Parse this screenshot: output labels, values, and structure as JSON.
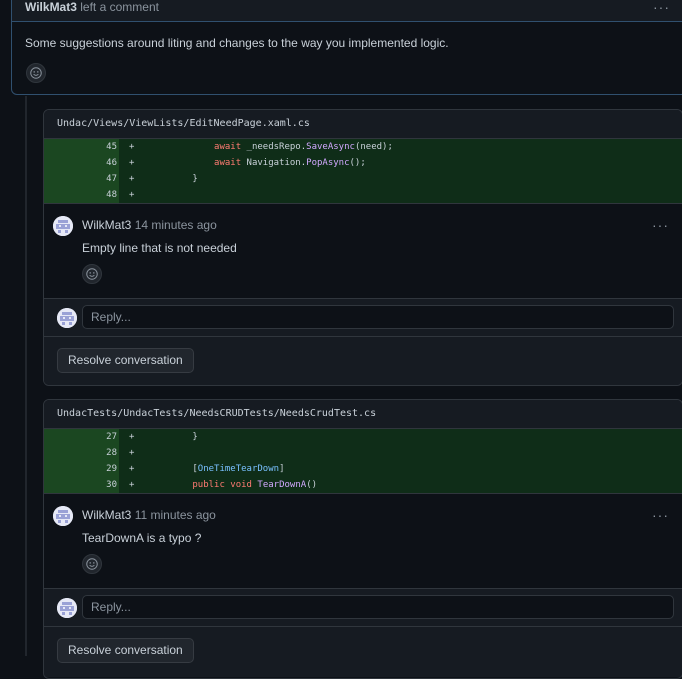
{
  "top_comment": {
    "author": "WilkMat3",
    "action": "left a comment",
    "body": "Some suggestions around liting and changes to the way you implemented logic.",
    "more_label": "···"
  },
  "threads": [
    {
      "file": "Undac/Views/ViewLists/EditNeedPage.xaml.cs",
      "lines": [
        {
          "num": "45",
          "sign": "+",
          "code_indent": "            ",
          "parts": [
            [
              "kw",
              "await"
            ],
            [
              "",
              " _needsRepo."
            ],
            [
              "fn",
              "SaveAsync"
            ],
            [
              "",
              "(need);"
            ]
          ]
        },
        {
          "num": "46",
          "sign": "+",
          "code_indent": "            ",
          "parts": [
            [
              "kw",
              "await"
            ],
            [
              "",
              " Navigation."
            ],
            [
              "fn",
              "PopAsync"
            ],
            [
              "",
              "();"
            ]
          ]
        },
        {
          "num": "47",
          "sign": "+",
          "code_indent": "        ",
          "parts": [
            [
              "",
              "}"
            ]
          ]
        },
        {
          "num": "48",
          "sign": "+",
          "code_indent": "",
          "parts": []
        }
      ],
      "comment": {
        "author": "WilkMat3",
        "time": "14 minutes ago",
        "body": "Empty line that is not needed",
        "more_label": "···"
      },
      "reply_placeholder": "Reply...",
      "resolve_label": "Resolve conversation"
    },
    {
      "file": "UndacTests/UndacTests/NeedsCRUDTests/NeedsCrudTest.cs",
      "lines": [
        {
          "num": "27",
          "sign": "+",
          "code_indent": "        ",
          "parts": [
            [
              "",
              "}"
            ]
          ]
        },
        {
          "num": "28",
          "sign": "+",
          "code_indent": "",
          "parts": []
        },
        {
          "num": "29",
          "sign": "+",
          "code_indent": "        ",
          "parts": [
            [
              "",
              "["
            ],
            [
              "attr",
              "OneTimeTearDown"
            ],
            [
              "",
              "]"
            ]
          ]
        },
        {
          "num": "30",
          "sign": "+",
          "code_indent": "        ",
          "parts": [
            [
              "kw",
              "public"
            ],
            [
              "",
              " "
            ],
            [
              "kw",
              "void"
            ],
            [
              "",
              " "
            ],
            [
              "fn",
              "TearDownA"
            ],
            [
              "",
              "()"
            ]
          ]
        }
      ],
      "comment": {
        "author": "WilkMat3",
        "time": "11 minutes ago",
        "body": "TearDownA is a typo ?",
        "more_label": "···"
      },
      "reply_placeholder": "Reply...",
      "resolve_label": "Resolve conversation"
    }
  ],
  "colors": {
    "background": "#0d1117",
    "diff_added": "#0f2d18",
    "keyword": "#ff7b72",
    "function": "#d2a8ff",
    "attribute": "#79c0ff"
  },
  "icons": {
    "emoji": "smiley-icon",
    "avatar": "identicon-avatar"
  }
}
